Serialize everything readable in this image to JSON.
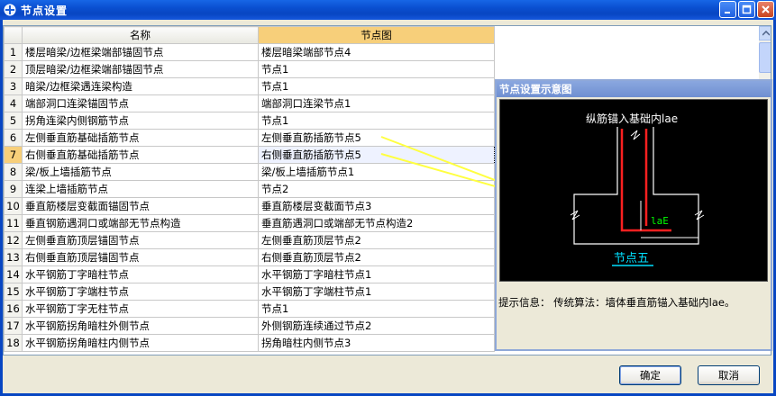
{
  "window": {
    "title": "节点设置"
  },
  "grid": {
    "columns": [
      "名称",
      "节点图"
    ],
    "rows": [
      {
        "num": "1",
        "name": "楼层暗梁/边框梁端部锚固节点",
        "node": "楼层暗梁端部节点4"
      },
      {
        "num": "2",
        "name": "顶层暗梁/边框梁端部锚固节点",
        "node": "节点1"
      },
      {
        "num": "3",
        "name": "暗梁/边框梁遇连梁构造",
        "node": "节点1"
      },
      {
        "num": "4",
        "name": "端部洞口连梁锚固节点",
        "node": "端部洞口连梁节点1"
      },
      {
        "num": "5",
        "name": "拐角连梁内侧钢筋节点",
        "node": "节点1"
      },
      {
        "num": "6",
        "name": "左侧垂直筋基础插筋节点",
        "node": "左侧垂直筋插筋节点5"
      },
      {
        "num": "7",
        "name": "右侧垂直筋基础插筋节点",
        "node": "右侧垂直筋插筋节点5"
      },
      {
        "num": "8",
        "name": "梁/板上墙插筋节点",
        "node": "梁/板上墙插筋节点1"
      },
      {
        "num": "9",
        "name": "连梁上墙插筋节点",
        "node": "节点2"
      },
      {
        "num": "10",
        "name": "垂直筋楼层变截面锚固节点",
        "node": "垂直筋楼层变截面节点3"
      },
      {
        "num": "11",
        "name": "垂直钢筋遇洞口或端部无节点构造",
        "node": "垂直筋遇洞口或端部无节点构造2"
      },
      {
        "num": "12",
        "name": "左侧垂直筋顶层锚固节点",
        "node": "左侧垂直筋顶层节点2"
      },
      {
        "num": "13",
        "name": "右侧垂直筋顶层锚固节点",
        "node": "右侧垂直筋顶层节点2"
      },
      {
        "num": "14",
        "name": "水平钢筋丁字暗柱节点",
        "node": "水平钢筋丁字暗柱节点1"
      },
      {
        "num": "15",
        "name": "水平钢筋丁字端柱节点",
        "node": "水平钢筋丁字端柱节点1"
      },
      {
        "num": "16",
        "name": "水平钢筋丁字无柱节点",
        "node": "节点1"
      },
      {
        "num": "17",
        "name": "水平钢筋拐角暗柱外侧节点",
        "node": "外侧钢筋连续通过节点2"
      },
      {
        "num": "18",
        "name": "水平钢筋拐角暗柱内侧节点",
        "node": "拐角暗柱内侧节点3"
      }
    ]
  },
  "diagram": {
    "title": "节点设置示意图",
    "top_label": "纵筋锚入基础内lae",
    "dim_label": "laE",
    "node_label": "节点五",
    "hint": "提示信息： 传统算法：墙体垂直筋锚入基础内lae。"
  },
  "buttons": {
    "ok": "确定",
    "cancel": "取消"
  },
  "colors": {
    "title_bar": "#0a4fd0",
    "active_header": "#f7cf7a",
    "link_text": "#2020c0",
    "rebar_red": "#ff2020",
    "dim_green": "#00ff00",
    "node_cyan": "#00e0ff",
    "arrow_yellow": "#ffff40"
  }
}
